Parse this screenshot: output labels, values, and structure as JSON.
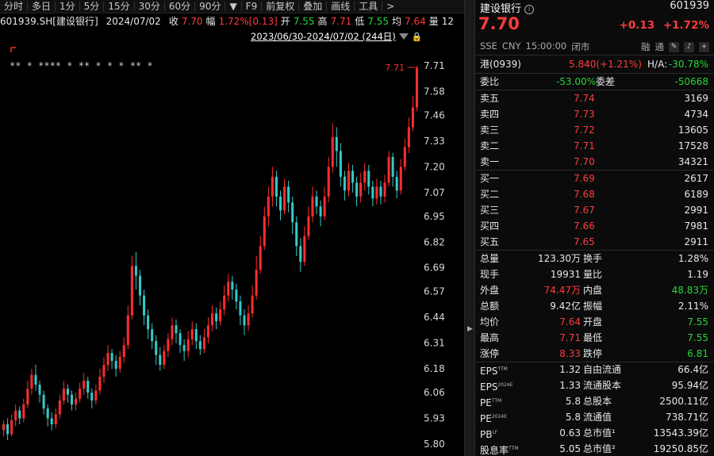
{
  "toolbar": {
    "items": [
      "分时",
      "多日",
      "1分",
      "5分",
      "15分",
      "30分",
      "60分",
      "90分",
      "▼",
      "F9",
      "前复权",
      "叠加",
      "画线",
      "工具",
      ">"
    ]
  },
  "infobar": {
    "symbol": "601939.SH[建设银行]",
    "date": "2024/07/02",
    "close_label": "收",
    "close_value": "7.70",
    "range_label": "幅",
    "range_value": "1.72%[0.13]",
    "open_label": "开",
    "open_value": "7.55",
    "high_label": "高",
    "high_value": "7.71",
    "low_label": "低",
    "low_value": "7.55",
    "avg_label": "均",
    "avg_value": "7.64",
    "vol_label": "量",
    "vol_value": "12"
  },
  "chart_header": {
    "date_range": "2023/06/30-2024/07/02 (244日)"
  },
  "chart_data": {
    "type": "candlestick",
    "y_ticks": [
      "7.71",
      "7.58",
      "7.46",
      "7.33",
      "7.20",
      "7.07",
      "6.95",
      "6.82",
      "6.69",
      "6.57",
      "6.44",
      "6.31",
      "6.18",
      "6.06",
      "5.93",
      "5.80"
    ],
    "ylim": [
      5.8,
      7.71
    ],
    "last_price_label": "7.71",
    "markers": "** * **** * ** * * * ** *",
    "colors": {
      "up": "#ff2d2d",
      "down": "#36c8c8",
      "bg": "#000000"
    },
    "candles": [
      [
        5.87,
        5.9,
        5.84,
        5.92
      ],
      [
        5.9,
        5.85,
        5.82,
        5.93
      ],
      [
        5.85,
        5.92,
        5.84,
        5.95
      ],
      [
        5.92,
        5.97,
        5.89,
        6.0
      ],
      [
        5.97,
        5.93,
        5.9,
        5.99
      ],
      [
        5.93,
        6.0,
        5.91,
        6.03
      ],
      [
        6.0,
        6.08,
        5.98,
        6.12
      ],
      [
        6.08,
        6.15,
        6.05,
        6.18
      ],
      [
        6.15,
        6.1,
        6.07,
        6.2
      ],
      [
        6.1,
        6.05,
        6.01,
        6.12
      ],
      [
        6.05,
        5.98,
        5.95,
        6.07
      ],
      [
        5.98,
        5.93,
        5.89,
        6.0
      ],
      [
        5.93,
        5.9,
        5.87,
        5.96
      ],
      [
        5.9,
        5.95,
        5.88,
        5.98
      ],
      [
        5.95,
        6.02,
        5.93,
        6.05
      ],
      [
        6.02,
        6.08,
        6.0,
        6.12
      ],
      [
        6.08,
        6.05,
        6.01,
        6.1
      ],
      [
        6.05,
        6.0,
        5.97,
        6.07
      ],
      [
        6.0,
        6.03,
        5.97,
        6.06
      ],
      [
        6.03,
        6.08,
        6.01,
        6.11
      ],
      [
        6.08,
        6.12,
        6.05,
        6.16
      ],
      [
        6.12,
        6.06,
        6.03,
        6.14
      ],
      [
        6.06,
        6.02,
        5.98,
        6.08
      ],
      [
        6.02,
        6.07,
        6.0,
        6.1
      ],
      [
        6.07,
        6.14,
        6.05,
        6.18
      ],
      [
        6.14,
        6.2,
        6.11,
        6.24
      ],
      [
        6.2,
        6.26,
        6.17,
        6.3
      ],
      [
        6.26,
        6.22,
        6.18,
        6.28
      ],
      [
        6.22,
        6.18,
        6.14,
        6.25
      ],
      [
        6.18,
        6.24,
        6.16,
        6.27
      ],
      [
        6.24,
        6.3,
        6.21,
        6.34
      ],
      [
        6.3,
        6.45,
        6.28,
        6.5
      ],
      [
        6.45,
        6.7,
        6.43,
        6.75
      ],
      [
        6.7,
        6.65,
        6.58,
        6.77
      ],
      [
        6.65,
        6.55,
        6.5,
        6.68
      ],
      [
        6.55,
        6.45,
        6.4,
        6.58
      ],
      [
        6.45,
        6.38,
        6.33,
        6.48
      ],
      [
        6.38,
        6.32,
        6.28,
        6.41
      ],
      [
        6.32,
        6.25,
        6.2,
        6.35
      ],
      [
        6.25,
        6.2,
        6.17,
        6.29
      ],
      [
        6.2,
        6.27,
        6.18,
        6.3
      ],
      [
        6.27,
        6.33,
        6.24,
        6.36
      ],
      [
        6.33,
        6.4,
        6.3,
        6.44
      ],
      [
        6.4,
        6.36,
        6.31,
        6.43
      ],
      [
        6.36,
        6.3,
        6.26,
        6.38
      ],
      [
        6.3,
        6.27,
        6.22,
        6.33
      ],
      [
        6.27,
        6.33,
        6.24,
        6.37
      ],
      [
        6.33,
        6.38,
        6.3,
        6.42
      ],
      [
        6.38,
        6.32,
        6.28,
        6.41
      ],
      [
        6.32,
        6.28,
        6.25,
        6.35
      ],
      [
        6.28,
        6.34,
        6.26,
        6.38
      ],
      [
        6.34,
        6.4,
        6.31,
        6.44
      ],
      [
        6.4,
        6.46,
        6.37,
        6.5
      ],
      [
        6.46,
        6.42,
        6.38,
        6.49
      ],
      [
        6.42,
        6.48,
        6.4,
        6.52
      ],
      [
        6.48,
        6.55,
        6.45,
        6.6
      ],
      [
        6.55,
        6.62,
        6.52,
        6.66
      ],
      [
        6.62,
        6.58,
        6.53,
        6.65
      ],
      [
        6.58,
        6.52,
        6.48,
        6.61
      ],
      [
        6.52,
        6.45,
        6.4,
        6.55
      ],
      [
        6.45,
        6.4,
        6.35,
        6.48
      ],
      [
        6.4,
        6.46,
        6.37,
        6.5
      ],
      [
        6.46,
        6.55,
        6.44,
        6.6
      ],
      [
        6.55,
        6.68,
        6.53,
        6.75
      ],
      [
        6.68,
        6.8,
        6.66,
        6.85
      ],
      [
        6.8,
        6.95,
        6.78,
        7.0
      ],
      [
        6.95,
        7.05,
        6.9,
        7.1
      ],
      [
        7.05,
        7.15,
        7.0,
        7.2
      ],
      [
        7.15,
        7.05,
        7.0,
        7.18
      ],
      [
        7.05,
        6.98,
        6.93,
        7.08
      ],
      [
        6.98,
        7.1,
        6.96,
        7.14
      ],
      [
        7.1,
        7.02,
        6.97,
        7.13
      ],
      [
        7.02,
        6.92,
        6.86,
        7.05
      ],
      [
        6.92,
        6.8,
        6.75,
        6.95
      ],
      [
        6.8,
        6.72,
        6.67,
        6.84
      ],
      [
        6.72,
        6.85,
        6.7,
        6.9
      ],
      [
        6.85,
        6.95,
        6.83,
        7.0
      ],
      [
        6.95,
        7.05,
        6.92,
        7.1
      ],
      [
        7.05,
        7.0,
        6.96,
        7.08
      ],
      [
        7.0,
        6.95,
        6.9,
        7.03
      ],
      [
        6.95,
        7.05,
        6.93,
        7.1
      ],
      [
        7.05,
        7.2,
        7.02,
        7.25
      ],
      [
        7.2,
        7.35,
        7.17,
        7.42
      ],
      [
        7.35,
        7.28,
        7.2,
        7.4
      ],
      [
        7.28,
        7.15,
        7.1,
        7.32
      ],
      [
        7.15,
        7.08,
        7.03,
        7.18
      ],
      [
        7.08,
        7.18,
        7.05,
        7.22
      ],
      [
        7.18,
        7.12,
        7.07,
        7.21
      ],
      [
        7.12,
        7.05,
        7.0,
        7.15
      ],
      [
        7.05,
        7.12,
        7.02,
        7.17
      ],
      [
        7.12,
        7.18,
        7.08,
        7.22
      ],
      [
        7.18,
        7.1,
        7.06,
        7.21
      ],
      [
        7.1,
        7.04,
        7.0,
        7.13
      ],
      [
        7.04,
        7.1,
        7.01,
        7.14
      ],
      [
        7.1,
        7.05,
        7.01,
        7.13
      ],
      [
        7.05,
        7.12,
        7.02,
        7.16
      ],
      [
        7.12,
        7.25,
        7.1,
        7.28
      ],
      [
        7.25,
        7.15,
        7.1,
        7.27
      ],
      [
        7.15,
        7.08,
        7.04,
        7.18
      ],
      [
        7.08,
        7.2,
        7.06,
        7.24
      ],
      [
        7.2,
        7.3,
        7.18,
        7.34
      ],
      [
        7.3,
        7.4,
        7.27,
        7.45
      ],
      [
        7.4,
        7.5,
        7.38,
        7.56
      ],
      [
        7.5,
        7.7,
        7.48,
        7.71
      ]
    ]
  },
  "quote": {
    "name": "建设银行",
    "info_icon": "info-icon",
    "code": "601939",
    "price": "7.70",
    "change": "+0.13",
    "change_pct": "+1.72%",
    "exchange": "SSE",
    "currency": "CNY",
    "time": "15:00:00",
    "status": "闭市",
    "tag_rong": "融",
    "tag_tong": "通",
    "hk_label": "港(0939)",
    "hk_value": "5.840(+1.21%)",
    "ha_label": "H/A:",
    "ha_value": "-30.78%",
    "weibi_label": "委比",
    "weibi_value": "-53.00%",
    "weicha_label": "委差",
    "weicha_value": "-50668"
  },
  "asks": [
    {
      "label": "卖五",
      "price": "7.74",
      "vol": "3169"
    },
    {
      "label": "卖四",
      "price": "7.73",
      "vol": "4734"
    },
    {
      "label": "卖三",
      "price": "7.72",
      "vol": "13605"
    },
    {
      "label": "卖二",
      "price": "7.71",
      "vol": "17528"
    },
    {
      "label": "卖一",
      "price": "7.70",
      "vol": "34321"
    }
  ],
  "bids": [
    {
      "label": "买一",
      "price": "7.69",
      "vol": "2617"
    },
    {
      "label": "买二",
      "price": "7.68",
      "vol": "6189"
    },
    {
      "label": "买三",
      "price": "7.67",
      "vol": "2991"
    },
    {
      "label": "买四",
      "price": "7.66",
      "vol": "7981"
    },
    {
      "label": "买五",
      "price": "7.65",
      "vol": "2911"
    }
  ],
  "stats": [
    {
      "l1": "总量",
      "v1": "123.30万",
      "l2": "换手",
      "v2": "1.28%",
      "c1": "white",
      "c2": "white"
    },
    {
      "l1": "现手",
      "v1": "19931",
      "l2": "量比",
      "v2": "1.19",
      "c1": "white",
      "c2": "white"
    },
    {
      "l1": "外盘",
      "v1": "74.47万",
      "l2": "内盘",
      "v2": "48.83万",
      "c1": "red",
      "c2": "green"
    },
    {
      "l1": "总额",
      "v1": "9.42亿",
      "l2": "振幅",
      "v2": "2.11%",
      "c1": "white",
      "c2": "white"
    },
    {
      "l1": "均价",
      "v1": "7.64",
      "l2": "开盘",
      "v2": "7.55",
      "c1": "red",
      "c2": "green"
    },
    {
      "l1": "最高",
      "v1": "7.71",
      "l2": "最低",
      "v2": "7.55",
      "c1": "red",
      "c2": "green"
    },
    {
      "l1": "涨停",
      "v1": "8.33",
      "l2": "跌停",
      "v2": "6.81",
      "c1": "red",
      "c2": "green"
    }
  ],
  "fundamentals": [
    {
      "l1": "EPS",
      "s1": "TTM",
      "v1": "1.32",
      "l2": "自由流通",
      "v2": "66.4亿"
    },
    {
      "l1": "EPS",
      "s1": "2024E",
      "v1": "1.33",
      "l2": "流通股本",
      "v2": "95.94亿"
    },
    {
      "l1": "PE",
      "s1": "TTM",
      "v1": "5.8",
      "l2": "总股本",
      "v2": "2500.11亿"
    },
    {
      "l1": "PE",
      "s1": "2024E",
      "v1": "5.8",
      "l2": "流通值",
      "v2": "738.71亿"
    },
    {
      "l1": "PB",
      "s1": "LF",
      "v1": "0.63",
      "l2": "总市值¹",
      "v2": "13543.39亿"
    },
    {
      "l1": "股息率",
      "s1": "TTM",
      "v1": "5.05",
      "l2": "总市值²",
      "v2": "19250.85亿"
    }
  ]
}
